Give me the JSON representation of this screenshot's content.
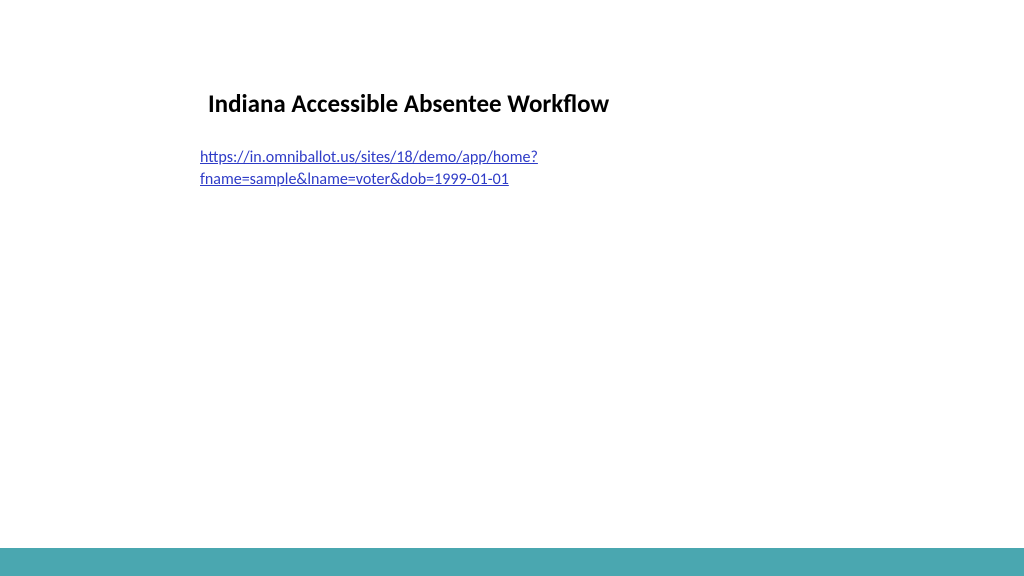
{
  "slide": {
    "title": "Indiana Accessible Absentee Workflow",
    "link_text": "https://in.omniballot.us/sites/18/demo/app/home?fname=sample&lname=voter&dob=1999-01-01"
  }
}
